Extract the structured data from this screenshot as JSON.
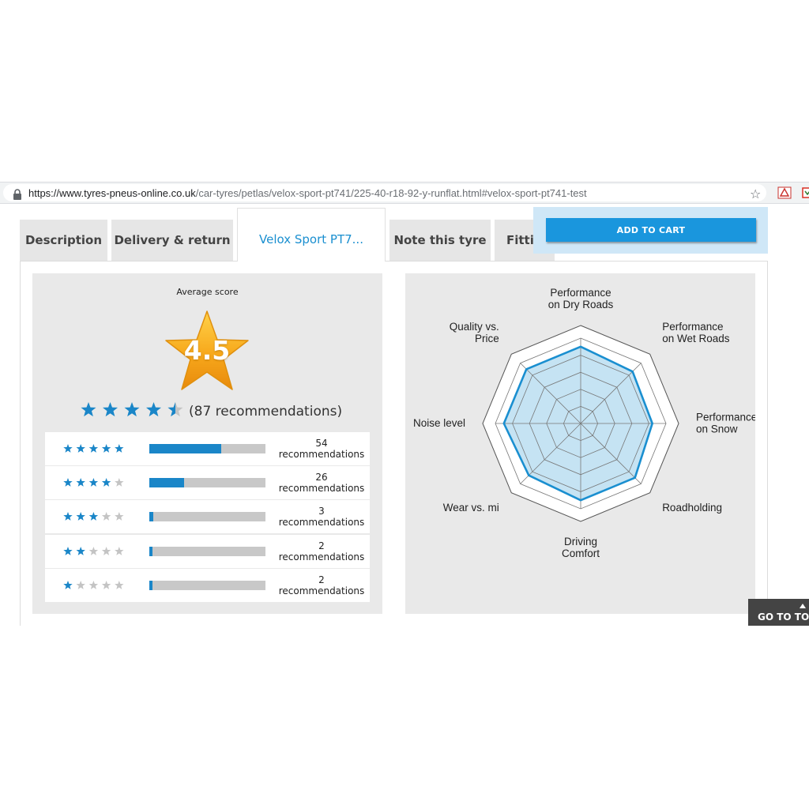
{
  "browser": {
    "url_host": "https://www.tyres-pneus-online.co.uk",
    "url_path": "/car-tyres/petlas/velox-sport-pt741/225-40-r18-92-y-runflat.html#velox-sport-pt741-test",
    "bookmark_icon": "star-outline-icon"
  },
  "tabs": {
    "description": "Description",
    "delivery": "Delivery & return",
    "velox": "Velox Sport PT7...",
    "note": "Note this tyre",
    "fitting": "Fittin"
  },
  "cart": {
    "button_label": "ADD TO CART"
  },
  "rating": {
    "average_label": "Average score",
    "score": "4.5",
    "score_value": 4.5,
    "recommendations_text": "(87 recommendations)",
    "breakdown": [
      {
        "stars": 5,
        "count": "54",
        "label": "recommendations",
        "fraction": 0.62
      },
      {
        "stars": 4,
        "count": "26",
        "label": "recommendations",
        "fraction": 0.3
      },
      {
        "stars": 3,
        "count": "3",
        "label": "recommendations",
        "fraction": 0.035
      },
      {
        "stars": 2,
        "count": "2",
        "label": "recommendations",
        "fraction": 0.025
      },
      {
        "stars": 1,
        "count": "2",
        "label": "recommendations",
        "fraction": 0.025
      }
    ],
    "star_color": "#1a86c8",
    "star_empty_color": "#c4c4c4"
  },
  "chart_data": {
    "type": "radar",
    "axes": [
      [
        "Performance",
        "on Dry Roads"
      ],
      [
        "Performance",
        "on Wet Roads"
      ],
      [
        "Performance",
        "on Snow"
      ],
      [
        "Roadholding"
      ],
      [
        "Driving",
        "Comfort"
      ],
      [
        "Wear vs. mi"
      ],
      [
        "Noise level"
      ],
      [
        "Quality vs.",
        "Price"
      ]
    ],
    "values": [
      4.5,
      4.3,
      4.2,
      4.5,
      4.5,
      4.3,
      4.5,
      4.5
    ],
    "max": 5,
    "rings": 5,
    "fill_color": "#c5e3f3",
    "line_color": "#1a8fd0"
  },
  "footer": {
    "go_top_label": "GO TO TOP"
  }
}
